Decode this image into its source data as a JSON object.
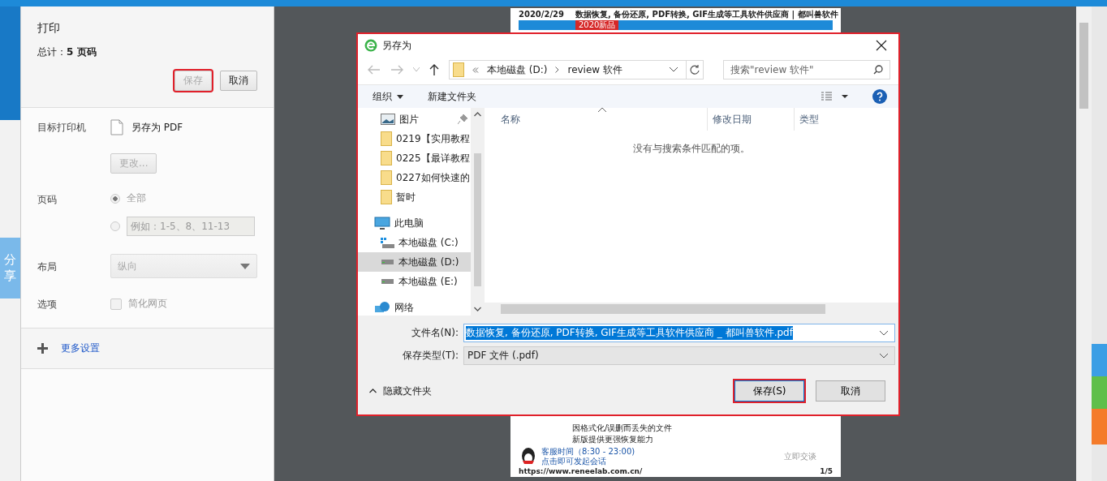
{
  "share_tab": "分享",
  "print_panel": {
    "title": "打印",
    "total": "总计：**5 页码**",
    "buttons": [
      {
        "label": "保存",
        "disabled": true,
        "focused": true
      },
      {
        "label": "取消",
        "disabled": false,
        "focused": false
      }
    ],
    "destination": {
      "label": "目标打印机",
      "value": "另存为 PDF",
      "change_button": "更改..."
    },
    "pages": {
      "label": "页码",
      "options": [
        {
          "kind": "radio",
          "label": "全部",
          "selected": true
        },
        {
          "kind": "input",
          "placeholder": "例如：1-5、8、11-13",
          "selected": false
        }
      ]
    },
    "layout": {
      "label": "布局",
      "value": "纵向"
    },
    "options": {
      "label": "选项",
      "checkbox": {
        "label": "简化网页",
        "checked": false
      }
    },
    "more_settings": "更多设置"
  },
  "preview": {
    "date": "2020/2/29",
    "heading": "数据恢复, 备份还原, PDF转换, GIF生成等工具软件供应商 | 都叫兽软件",
    "banner_tag": "2020新品",
    "lines": [
      "因格式化/误删而丢失的文件",
      "新版提供更强恢复能力"
    ],
    "service_hours": "客服时间（8:30 - 23:00)",
    "service_hint": "点击即可发起会话",
    "chat_link": "立即交谈",
    "url": "https://www.reneelab.com.cn/",
    "page_number": "1/5"
  },
  "dialog": {
    "title": "另存为",
    "breadcrumb": [
      "本地磁盘 (D:)",
      "review 软件"
    ],
    "search_placeholder": "搜索\"review 软件\"",
    "toolbar": [
      "组织",
      "新建文件夹"
    ],
    "nav": [
      {
        "kind": "pictures",
        "label": "图片",
        "pinned": true,
        "selected": false
      },
      {
        "kind": "folder",
        "label": "0219【实用教程",
        "pinned": false,
        "selected": false
      },
      {
        "kind": "folder",
        "label": "0225【最详教程",
        "pinned": false,
        "selected": false
      },
      {
        "kind": "folder",
        "label": "0227如何快速的",
        "pinned": false,
        "selected": false
      },
      {
        "kind": "folder",
        "label": "暂时",
        "pinned": false,
        "selected": false
      },
      {
        "kind": "computer",
        "label": "此电脑",
        "pinned": false,
        "selected": false,
        "children": [
          {
            "kind": "system-drive",
            "label": "本地磁盘 (C:)",
            "pinned": false,
            "selected": false
          },
          {
            "kind": "drive",
            "label": "本地磁盘 (D:)",
            "pinned": false,
            "selected": true
          },
          {
            "kind": "drive",
            "label": "本地磁盘 (E:)",
            "pinned": false,
            "selected": false
          }
        ]
      },
      {
        "kind": "network",
        "label": "网络",
        "pinned": false,
        "selected": false
      }
    ],
    "columns": [
      {
        "label": "名称",
        "sorted": true
      },
      {
        "label": "修改日期",
        "sorted": false
      },
      {
        "label": "类型",
        "sorted": false
      }
    ],
    "empty_message": "没有与搜索条件匹配的项。",
    "file_name_label": "文件名(N):",
    "file_name": "数据恢复, 备份还原, PDF转换, GIF生成等工具软件供应商 _ 都叫兽软件.pdf",
    "file_type_label": "保存类型(T):",
    "file_type": "PDF 文件 (.pdf)",
    "hide_folders": "隐藏文件夹",
    "buttons": [
      {
        "label": "保存(S)",
        "focused": true
      },
      {
        "label": "取消",
        "focused": false
      }
    ]
  }
}
